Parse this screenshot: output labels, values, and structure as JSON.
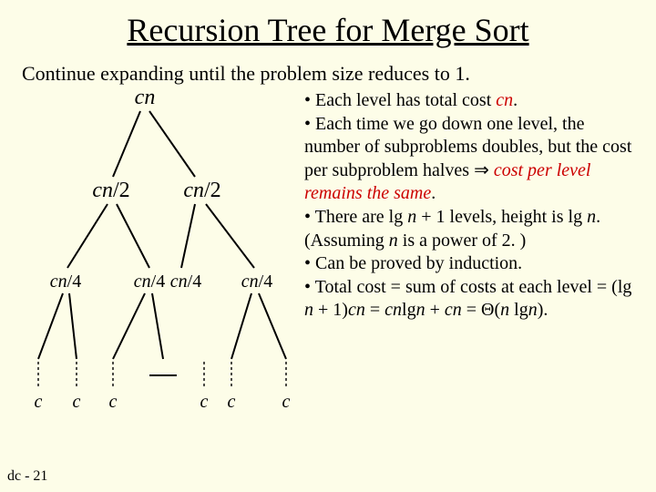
{
  "title": "Recursion Tree for Merge Sort",
  "subtitle": "Continue expanding until the problem size reduces to 1.",
  "tree": {
    "root": "cn",
    "l1a": "cn",
    "l1a_suf": "/2",
    "l1b": "cn",
    "l1b_suf": "/2",
    "l2a": "cn",
    "l2a_suf": "/4",
    "l2b": "cn",
    "l2b_suf": "/4",
    "l2c": "cn",
    "l2c_suf": "/4",
    "l2d": "cn",
    "l2d_suf": "/4",
    "leaf": "c"
  },
  "bullets": {
    "b1_pre": "• Each level has total cost ",
    "b1_em": "cn",
    "b1_post": ".",
    "b2": "• Each time we go down one level, the number of subproblems doubles, but the cost per subproblem halves ",
    "b2_sym": "⇒",
    "b2_em": " cost per level remains the same",
    "b2_post": ".",
    "b3a": "• There are lg ",
    "b3b": "n",
    "b3c": " + 1 levels, height is lg ",
    "b3d": "n",
    "b3e": ". (Assuming ",
    "b3f": "n",
    "b3g": " is a power of 2. )",
    "b4": "• Can be proved by induction.",
    "b5a": "• Total cost = sum of costs at each level = (lg ",
    "b5b": "n",
    "b5c": " + 1)",
    "b5d": "cn",
    "b5e": " = ",
    "b5f": "cn",
    "b5g": "lg",
    "b5h": "n",
    "b5i": " + ",
    "b5j": "cn",
    "b5k": " = Θ(",
    "b5l": "n",
    "b5m": " lg",
    "b5n": "n",
    "b5o": ")."
  },
  "footer": "dc - 21"
}
